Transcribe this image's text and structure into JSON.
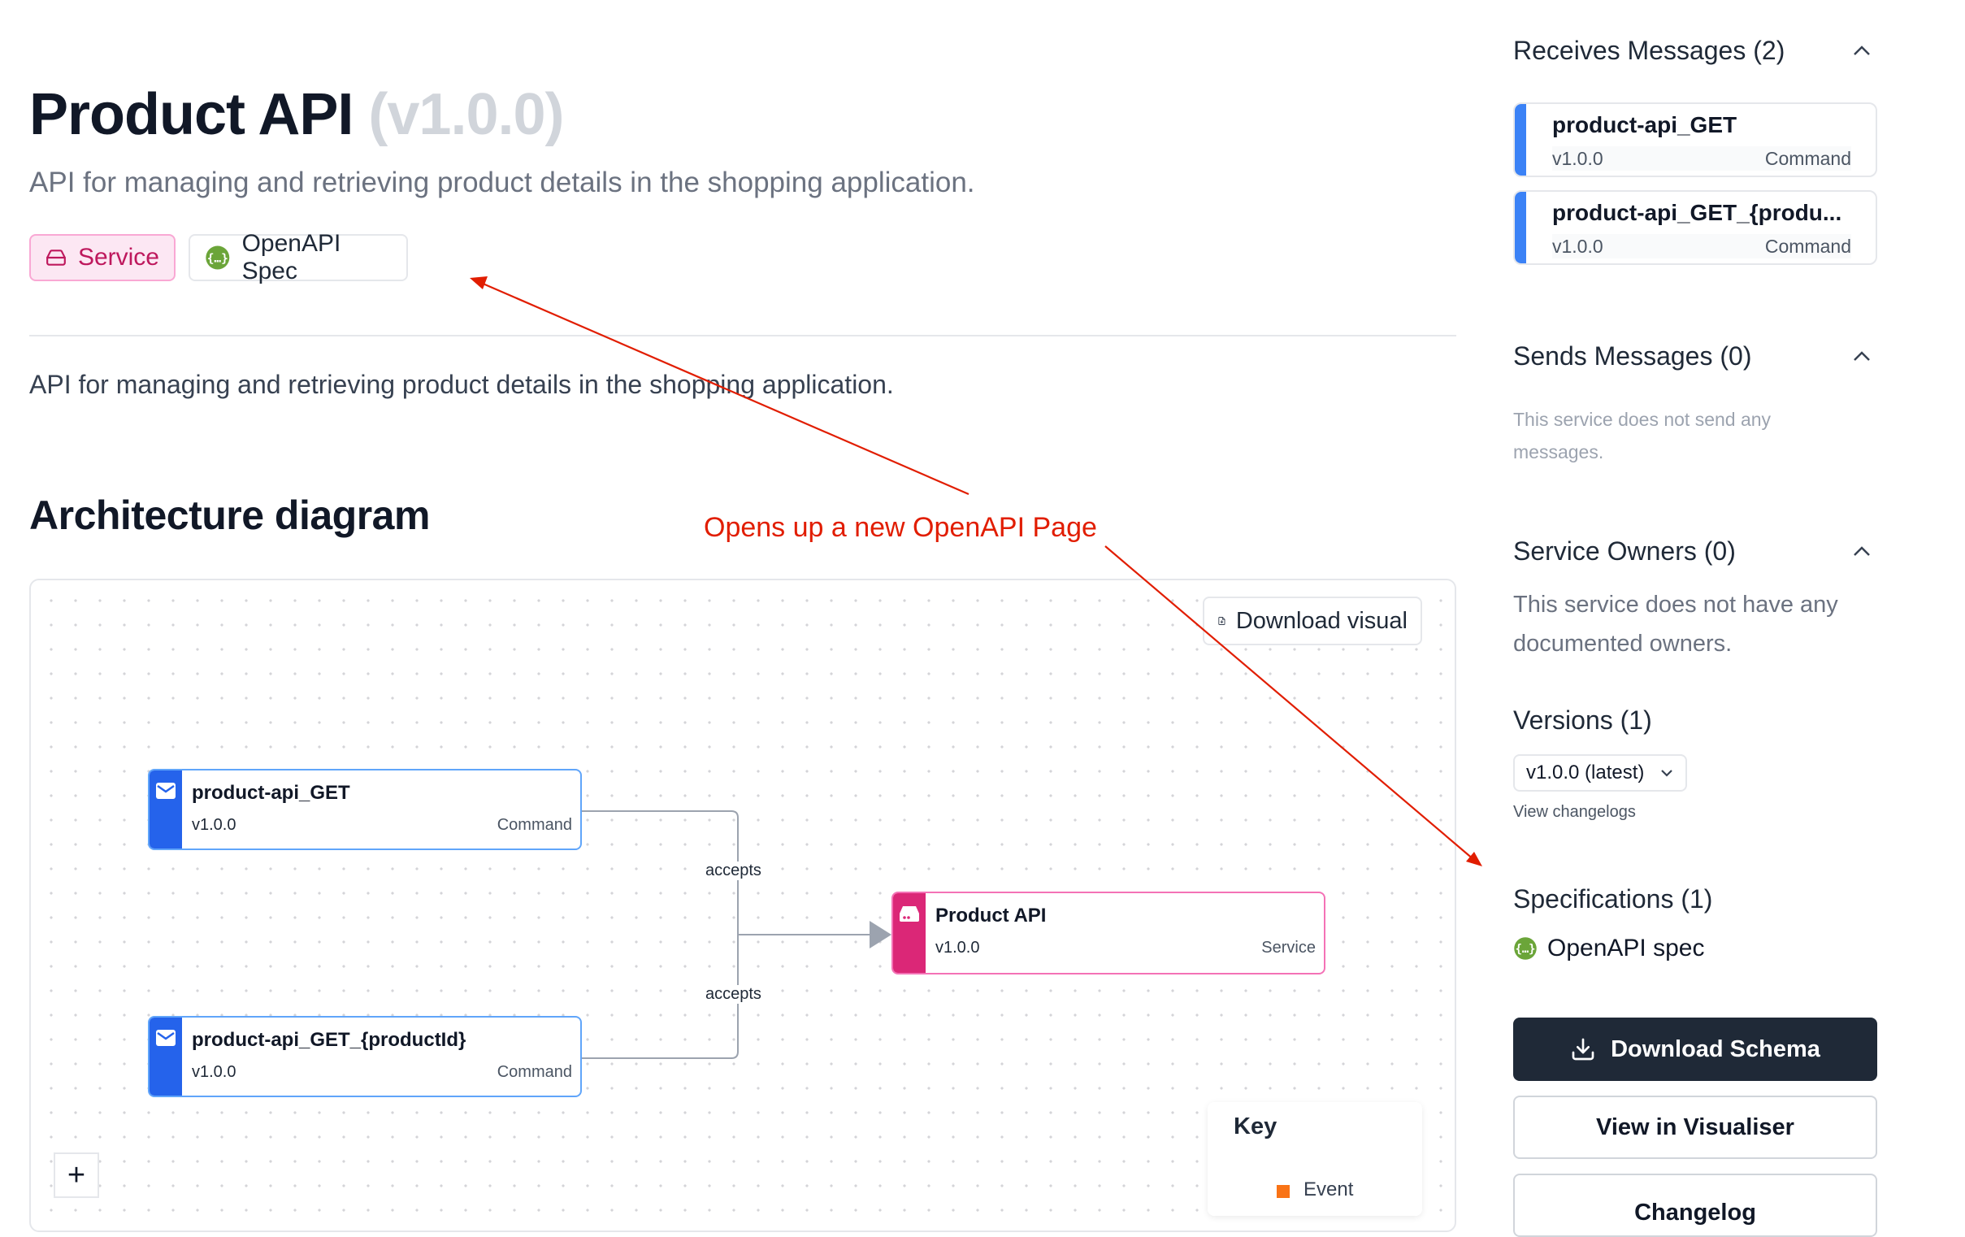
{
  "header": {
    "title": "Product API",
    "version_label": "(v1.0.0)",
    "subtitle": "API for managing and retrieving product details in the shopping application."
  },
  "badges": {
    "service": "Service",
    "openapi": "OpenAPI Spec"
  },
  "summary": "API for managing and retrieving product details in the shopping application.",
  "architecture": {
    "heading": "Architecture diagram",
    "download_visual": "Download visual",
    "nodes": [
      {
        "name": "product-api_GET",
        "version": "v1.0.0",
        "type": "Command",
        "icon": "envelope-icon"
      },
      {
        "name": "product-api_GET_{productId}",
        "version": "v1.0.0",
        "type": "Command",
        "icon": "envelope-icon"
      },
      {
        "name": "Product API",
        "version": "v1.0.0",
        "type": "Service",
        "icon": "server-icon"
      }
    ],
    "edges": [
      "accepts",
      "accepts"
    ],
    "zoom_in": "+",
    "key": {
      "title": "Key",
      "items": [
        {
          "label": "Event",
          "color": "#f97316"
        }
      ]
    }
  },
  "annotation": "Opens up a new OpenAPI Page",
  "sidebar": {
    "receives": {
      "title": "Receives Messages (2)",
      "messages": [
        {
          "name": "product-api_GET",
          "version": "v1.0.0",
          "type": "Command"
        },
        {
          "name": "product-api_GET_{produ...",
          "version": "v1.0.0",
          "type": "Command"
        }
      ]
    },
    "sends": {
      "title": "Sends Messages (0)",
      "empty": "This service does not send any messages."
    },
    "owners": {
      "title": "Service Owners (0)",
      "empty": "This service does not have any documented owners."
    },
    "versions": {
      "title": "Versions (1)",
      "selected": "v1.0.0 (latest)",
      "changelogs_link": "View changelogs"
    },
    "specifications": {
      "title": "Specifications (1)",
      "items": [
        "OpenAPI spec"
      ]
    },
    "buttons": {
      "download_schema": "Download Schema",
      "view_visualiser": "View in Visualiser",
      "changelog": "Changelog"
    }
  },
  "colors": {
    "service_pink": "#db2777",
    "command_blue": "#2563eb",
    "annotation_red": "#e11d00",
    "primary_button": "#1f2937"
  }
}
